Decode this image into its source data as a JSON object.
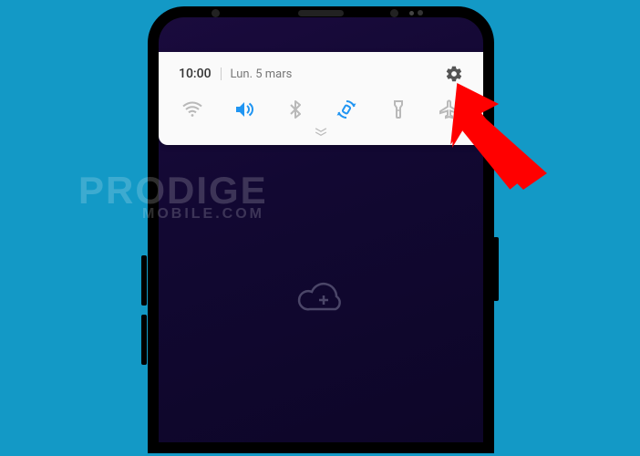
{
  "statusbar": {
    "time": "10:00",
    "date": "Lun. 5 mars"
  },
  "quicksettings": {
    "wifi": "wifi-icon",
    "sound": "volume-icon",
    "bluetooth": "bluetooth-icon",
    "autorotate": "auto-rotate-icon",
    "flashlight": "flashlight-icon",
    "airplane": "airplane-mode-icon"
  },
  "watermark": {
    "line1": "PRODIGE",
    "line2": "MOBILE.COM"
  },
  "colors": {
    "bg": "#1399c6",
    "active": "#2095f2",
    "inactive": "#b9b9b9",
    "arrow": "#ff0000"
  }
}
